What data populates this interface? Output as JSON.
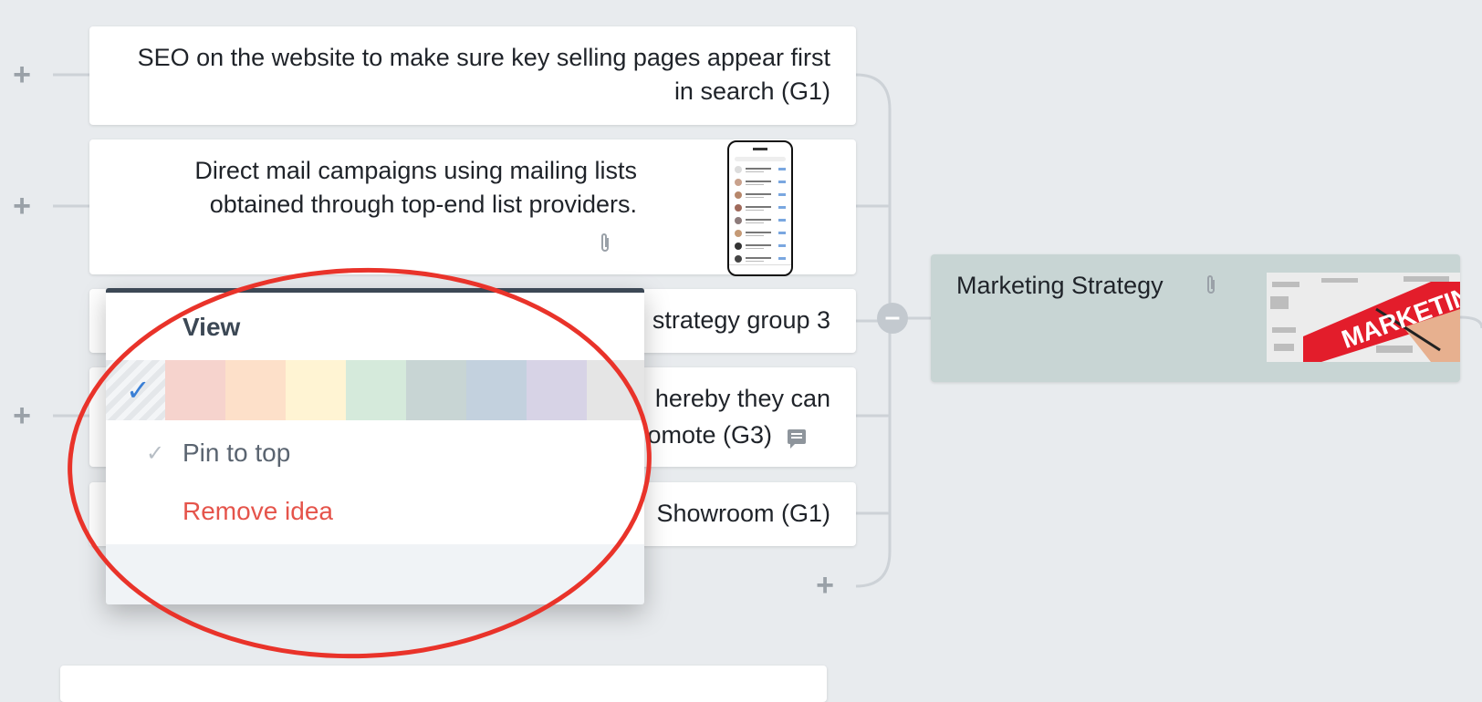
{
  "cards": [
    {
      "text": "SEO on the website to make sure key selling pages appear first in search (G1)"
    },
    {
      "text": "Direct mail campaigns using mailing lists obtained through top-end list providers."
    },
    {
      "text": "strategy group 3"
    },
    {
      "text_line1": "hereby they can",
      "text_line2": "omote (G3)"
    },
    {
      "text": "Showroom (G1)"
    }
  ],
  "central_node": {
    "title": "Marketing Strategy",
    "image_text": "MARKETING"
  },
  "popup": {
    "title": "View",
    "colors": [
      "#f6d3cd",
      "#fde0c9",
      "#fff4d3",
      "#d5eadb",
      "#c8d5d4",
      "#c3d1de",
      "#d7d3e6",
      "#e5e5e5"
    ],
    "pin_label": "Pin to top",
    "remove_label": "Remove idea"
  },
  "icons": {
    "plus": "plus-icon",
    "attachment": "paperclip-icon",
    "comment": "comment-icon",
    "collapse": "minus-icon"
  },
  "accent": {
    "annotation": "#e9332a",
    "remove": "#e5544b",
    "selected_check": "#3a7fd5"
  }
}
